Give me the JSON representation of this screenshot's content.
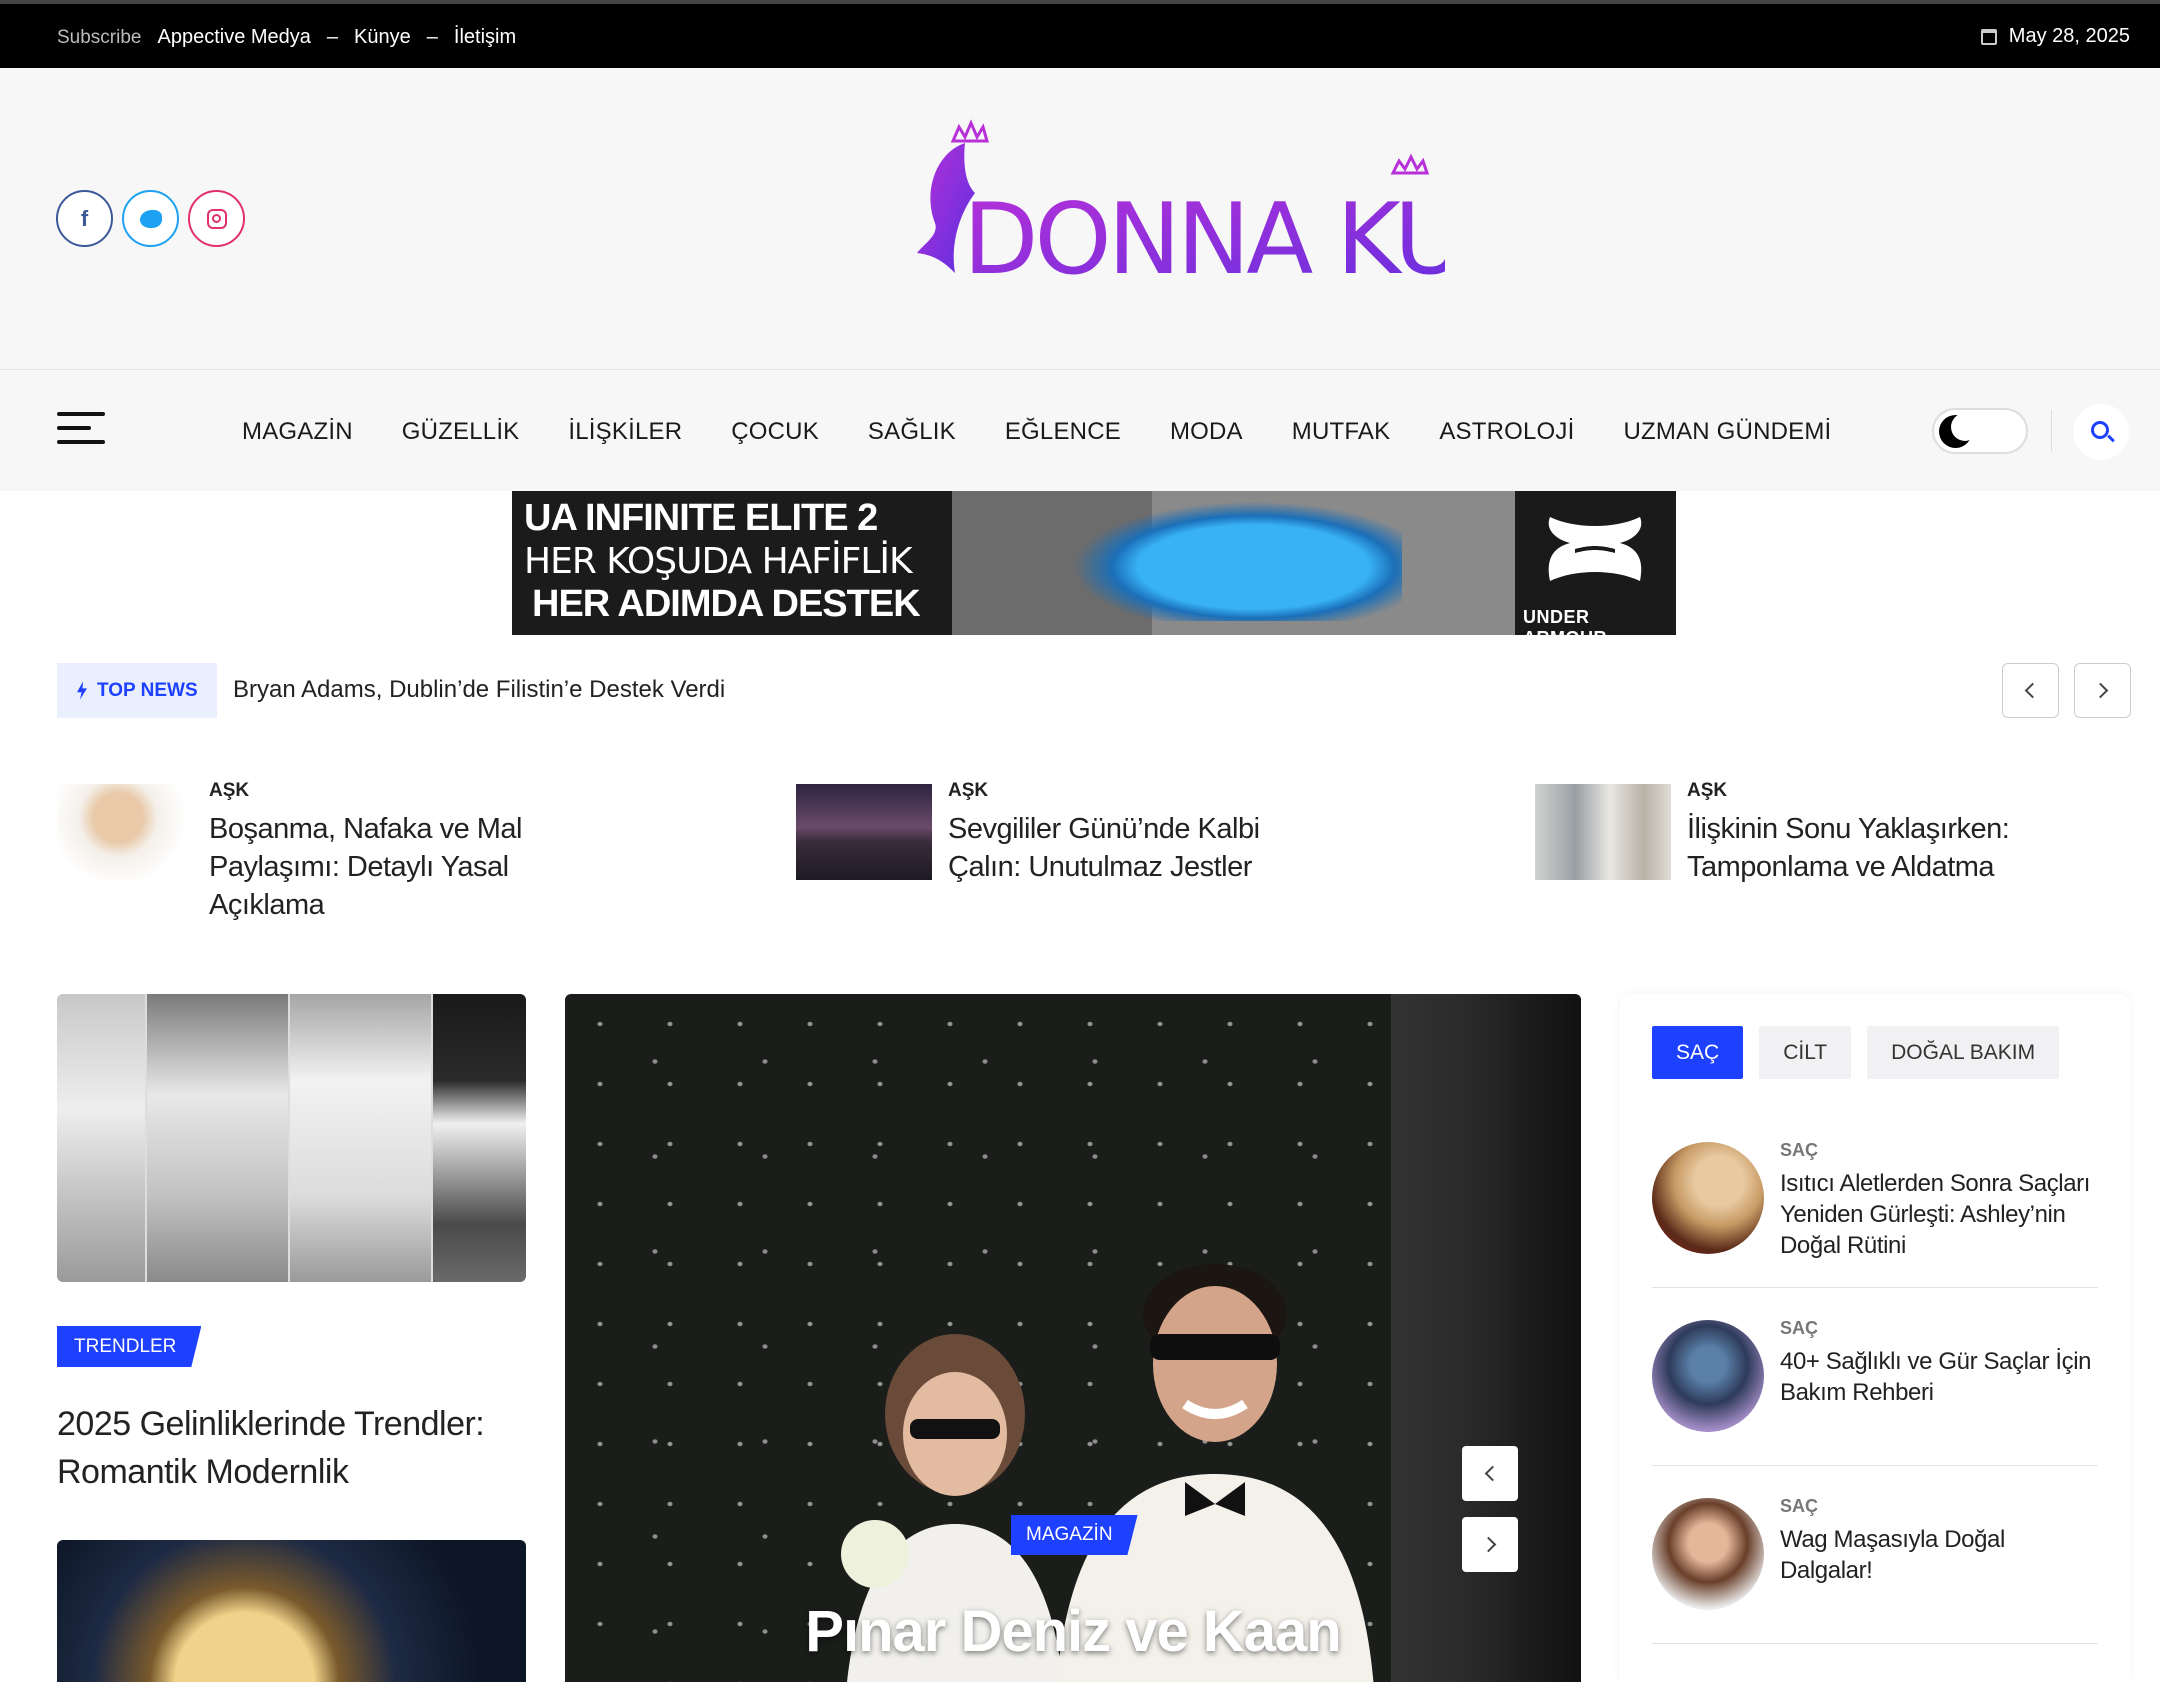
{
  "topbar": {
    "subscribe": "Subscribe",
    "links": [
      "Appective Medya",
      "Künye",
      "İletişim"
    ],
    "separator": "–",
    "date": "May 28, 2025"
  },
  "header": {
    "logo_text": "DONNA KULİS",
    "social": [
      "facebook",
      "twitter",
      "instagram"
    ]
  },
  "nav": {
    "items": [
      "MAGAZİN",
      "GÜZELLİK",
      "İLİŞKİLER",
      "ÇOCUK",
      "SAĞLIK",
      "EĞLENCE",
      "MODA",
      "MUTFAK",
      "ASTROLOJİ",
      "UZMAN GÜNDEMİ"
    ]
  },
  "ad": {
    "line1": "UA INFINITE ELITE 2",
    "line2": "HER KOŞUDA HAFİFLİK",
    "line3": "HER ADIMDA DESTEK",
    "brand": "UNDER ARMOUR"
  },
  "ticker": {
    "badge": "TOP NEWS",
    "headline": "Bryan Adams, Dublin’de Filistin’e Destek Verdi"
  },
  "featured": [
    {
      "category": "AŞK",
      "title": "Boşanma, Nafaka ve Mal Paylaşımı: Detaylı Yasal Açıklama"
    },
    {
      "category": "AŞK",
      "title": "Sevgililer Günü’nde Kalbi Çalın: Unutulmaz Jestler"
    },
    {
      "category": "AŞK",
      "title": "İlişkinin Sonu Yaklaşırken: Tamponlama ve Aldatma"
    }
  ],
  "left_story": {
    "tag": "TRENDLER",
    "title": "2025 Gelinliklerinde Trendler: Romantik Modernlik"
  },
  "hero": {
    "tag": "MAGAZİN",
    "title": "Pınar Deniz ve Kaan"
  },
  "sidebar": {
    "tabs": [
      "SAÇ",
      "CİLT",
      "DOĞAL BAKIM"
    ],
    "items": [
      {
        "category": "SAÇ",
        "title": "Isıtıcı Aletlerden Sonra Saçları Yeniden Gürleşti: Ashley’nin Doğal Rütini"
      },
      {
        "category": "SAÇ",
        "title": "40+ Sağlıklı ve Gür Saçlar İçin Bakım Rehberi"
      },
      {
        "category": "SAÇ",
        "title": "Wag Maşasıyla Doğal Dalgalar!"
      }
    ]
  },
  "colors": {
    "accent": "#1e40ff",
    "logo_purple": "#8a2be2",
    "topbar": "#000000"
  }
}
